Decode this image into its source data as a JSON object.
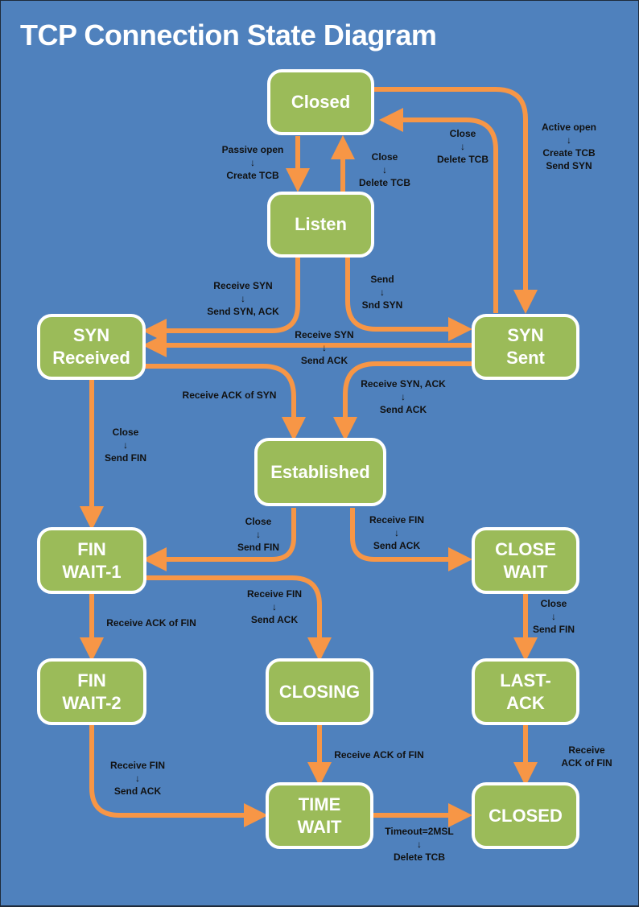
{
  "title": "TCP Connection State Diagram",
  "colors": {
    "background": "#4f81bd",
    "node_fill": "#9bbb59",
    "node_border": "#ffffff",
    "edge": "#f79646",
    "label_text": "#111111"
  },
  "states": {
    "closed_top": "Closed",
    "listen": "Listen",
    "syn_received": "SYN\nReceived",
    "syn_sent": "SYN\nSent",
    "established": "Established",
    "fin_wait_1": "FIN\nWAIT-1",
    "close_wait": "CLOSE\nWAIT",
    "fin_wait_2": "FIN\nWAIT-2",
    "closing": "CLOSING",
    "last_ack": "LAST-\nACK",
    "time_wait": "TIME\nWAIT",
    "closed_bottom": "CLOSED"
  },
  "transitions": [
    {
      "id": "passive_open",
      "from": "Closed",
      "to": "Listen",
      "label": "Passive open\n↓\nCreate TCB"
    },
    {
      "id": "listen_close",
      "from": "Listen",
      "to": "Closed",
      "label": "Close\n↓\nDelete TCB"
    },
    {
      "id": "synsent_close",
      "from": "SYN Sent",
      "to": "Closed",
      "label": "Close\n↓\nDelete TCB"
    },
    {
      "id": "active_open",
      "from": "Closed",
      "to": "SYN Sent",
      "label": "Active open\n↓\nCreate TCB\nSend SYN"
    },
    {
      "id": "listen_recv_syn",
      "from": "Listen",
      "to": "SYN Received",
      "label": "Receive SYN\n↓\nSend SYN, ACK"
    },
    {
      "id": "listen_send",
      "from": "Listen",
      "to": "SYN Sent",
      "label": "Send\n↓\nSnd SYN"
    },
    {
      "id": "synsent_recv_syn",
      "from": "SYN Sent",
      "to": "SYN Received",
      "label": "Receive SYN\n↓\nSend ACK"
    },
    {
      "id": "synrcvd_ack",
      "from": "SYN Received",
      "to": "Established",
      "label": "Receive ACK of SYN"
    },
    {
      "id": "synsent_synack",
      "from": "SYN Sent",
      "to": "Established",
      "label": "Receive SYN, ACK\n↓\nSend ACK"
    },
    {
      "id": "synrcvd_close",
      "from": "SYN Received",
      "to": "FIN WAIT-1",
      "label": "Close\n↓\nSend FIN"
    },
    {
      "id": "est_close",
      "from": "Established",
      "to": "FIN WAIT-1",
      "label": "Close\n↓\nSend FIN"
    },
    {
      "id": "est_recv_fin",
      "from": "Established",
      "to": "CLOSE WAIT",
      "label": "Receive FIN\n↓\nSend ACK"
    },
    {
      "id": "fw1_ack",
      "from": "FIN WAIT-1",
      "to": "FIN WAIT-2",
      "label": "Receive ACK of FIN"
    },
    {
      "id": "fw1_fin",
      "from": "FIN WAIT-1",
      "to": "CLOSING",
      "label": "Receive FIN\n↓\nSend ACK"
    },
    {
      "id": "cw_close",
      "from": "CLOSE WAIT",
      "to": "LAST-ACK",
      "label": "Close\n↓\nSend FIN"
    },
    {
      "id": "fw2_fin",
      "from": "FIN WAIT-2",
      "to": "TIME WAIT",
      "label": "Receive FIN\n↓\nSend ACK"
    },
    {
      "id": "closing_ack",
      "from": "CLOSING",
      "to": "TIME WAIT",
      "label": "Receive ACK of FIN"
    },
    {
      "id": "lastack_ack",
      "from": "LAST-ACK",
      "to": "CLOSED",
      "label": "Receive ACK of FIN"
    },
    {
      "id": "tw_timeout",
      "from": "TIME WAIT",
      "to": "CLOSED",
      "label": "Timeout=2MSL\n↓\nDelete TCB"
    }
  ]
}
